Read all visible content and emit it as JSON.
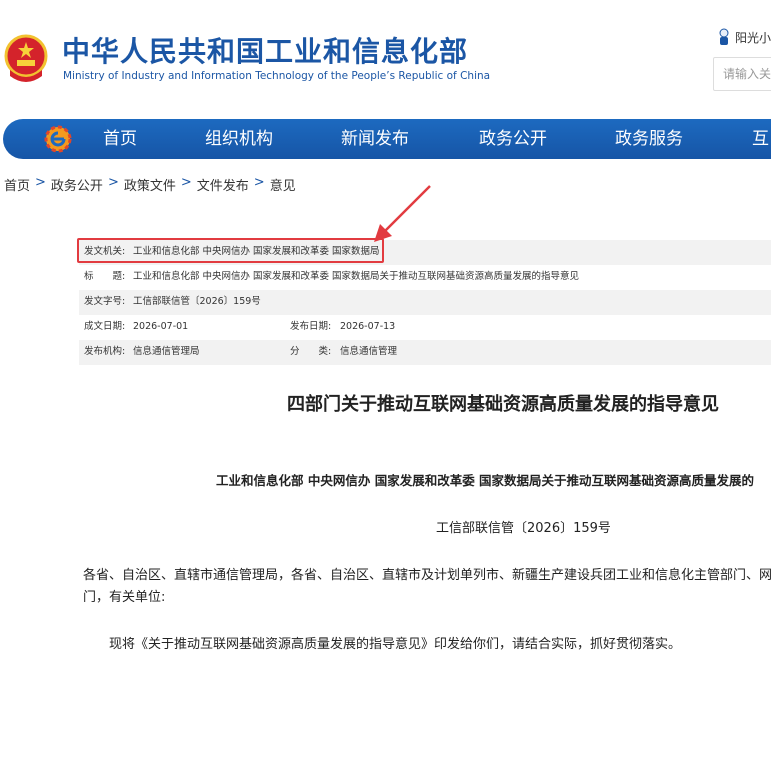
{
  "header": {
    "title_cn": "中华人民共和国工业和信息化部",
    "title_en": "Ministry of Industry and Information Technology of the People’s Republic of China",
    "sun_link": "阳光小",
    "search_placeholder": "请输入关"
  },
  "nav": {
    "items": [
      "首页",
      "组织机构",
      "新闻发布",
      "政务公开",
      "政务服务",
      "互"
    ]
  },
  "breadcrumb": {
    "items": [
      "首页",
      "政务公开",
      "政策文件",
      "文件发布",
      "意见"
    ],
    "separator": ">"
  },
  "info": {
    "issuer_label": "发文机关:",
    "issuer": "工业和信息化部 中央网信办 国家发展和改革委 国家数据局",
    "title_label": "标　　题:",
    "title": "工业和信息化部 中央网信办 国家发展和改革委 国家数据局关于推动互联网基础资源高质量发展的指导意见",
    "docno_label": "发文字号:",
    "docno": "工信部联信管〔2026〕159号",
    "created_label": "成文日期:",
    "created": "2026-07-01",
    "published_label": "发布日期:",
    "published": "2026-07-13",
    "org_label": "发布机构:",
    "org": "信息通信管理局",
    "category_label": "分　　类:",
    "category": "信息通信管理"
  },
  "article": {
    "title": "四部门关于推动互联网基础资源高质量发展的指导意见",
    "subtitle": "工业和信息化部 中央网信办 国家发展和改革委 国家数据局关于推动互联网基础资源高质量发展的",
    "docnum": "工信部联信管〔2026〕159号",
    "para1_line1": "各省、自治区、直辖市通信管理局，各省、自治区、直辖市及计划单列市、新疆生产建设兵团工业和信息化主管部门、网信",
    "para1_line2": "门，有关单位:",
    "para2": "现将《关于推动互联网基础资源高质量发展的指导意见》印发给你们，请结合实际，抓好贯彻落实。"
  },
  "colors": {
    "brand_blue": "#1b56a5",
    "nav_blue": "#1d6ac0",
    "highlight_red": "#e23b40"
  }
}
